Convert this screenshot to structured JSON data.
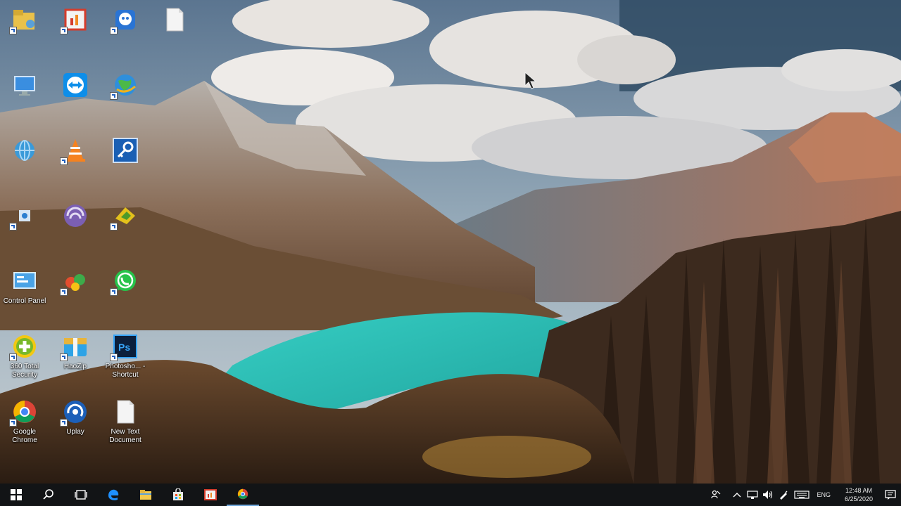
{
  "desktop": {
    "icons": [
      {
        "label": ""
      },
      {
        "label": ""
      },
      {
        "label": ""
      },
      {
        "label": ""
      },
      {
        "label": ""
      },
      {
        "label": ""
      },
      {
        "label": ""
      },
      {
        "label": ""
      },
      {
        "label": ""
      },
      {
        "label": ""
      },
      {
        "label": ""
      },
      {
        "label": ""
      },
      {
        "label": ""
      },
      {
        "label": "Control Panel"
      },
      {
        "label": ""
      },
      {
        "label": ""
      },
      {
        "label": "360 Total Security"
      },
      {
        "label": "HaoZip"
      },
      {
        "label": "Photosho... - Shortcut"
      },
      {
        "label": "Google Chrome"
      },
      {
        "label": "Uplay"
      },
      {
        "label": "New Text Document"
      }
    ]
  },
  "taskbar": {
    "language": "ENG",
    "time": "12:48 AM",
    "date": "6/25/2020"
  }
}
